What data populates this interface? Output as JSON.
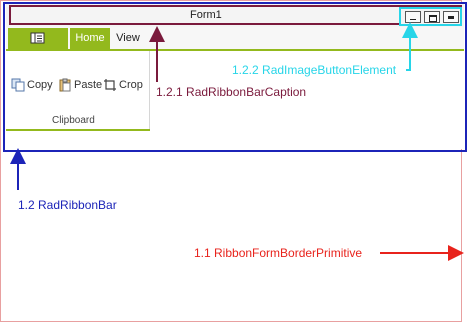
{
  "form": {
    "title": "Form1"
  },
  "ribbon": {
    "tabs": [
      {
        "label": "Home",
        "active": true
      },
      {
        "label": "View",
        "active": false
      }
    ],
    "commands": [
      {
        "label": "Copy",
        "icon": "copy-icon"
      },
      {
        "label": "Paste",
        "icon": "paste-icon"
      },
      {
        "label": "Crop",
        "icon": "crop-icon"
      }
    ],
    "group_label": "Clipboard"
  },
  "annotations": {
    "image_button": "1.2.2 RadImageButtonElement",
    "caption": "1.2.1 RadRibbonBarCaption",
    "ribbon_bar": "1.2 RadRibbonBar",
    "border": "1.1 RibbonFormBorderPrimitive"
  },
  "colors": {
    "ribbon_bar": "#1c24b8",
    "caption": "#7a1a3c",
    "image_button": "#27d5e8",
    "border": "#e8231c",
    "accent_green": "#93b91d"
  }
}
